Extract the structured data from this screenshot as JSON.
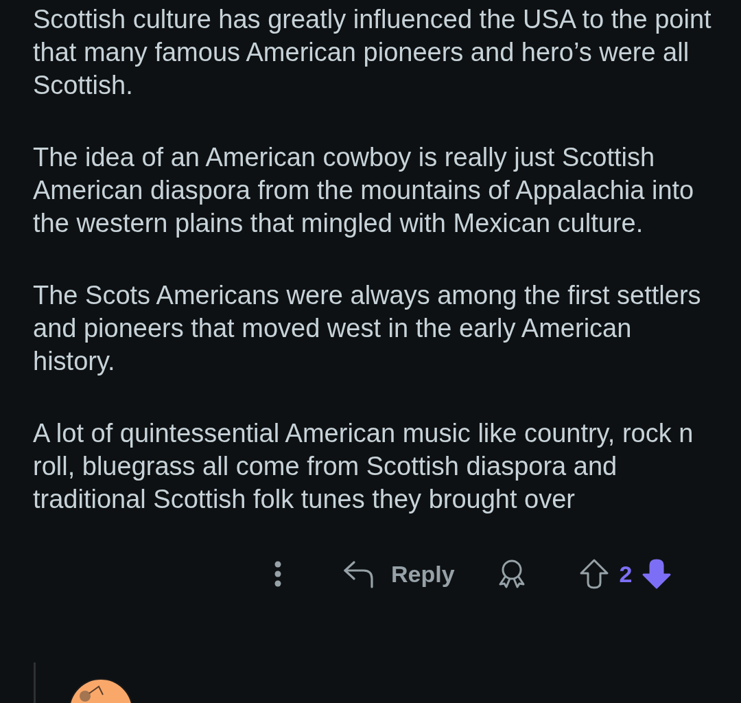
{
  "paragraphs": [
    "Scottish culture has greatly influenced the USA to the point that many famous American pioneers and hero’s were all Scottish.",
    "The idea of an American cowboy is really just Scottish American diaspora from the mountains of Appalachia into the western plains that mingled with Mexican culture.",
    "The Scots Americans were always among the first settlers and pioneers that moved west in the early American history.",
    "A lot of quintessential American music like country, rock n roll, bluegrass all come from Scottish diaspora and traditional Scottish folk tunes they brought over"
  ],
  "actions": {
    "reply_label": "Reply",
    "score": "2",
    "upvoted": false,
    "downvoted": true
  }
}
